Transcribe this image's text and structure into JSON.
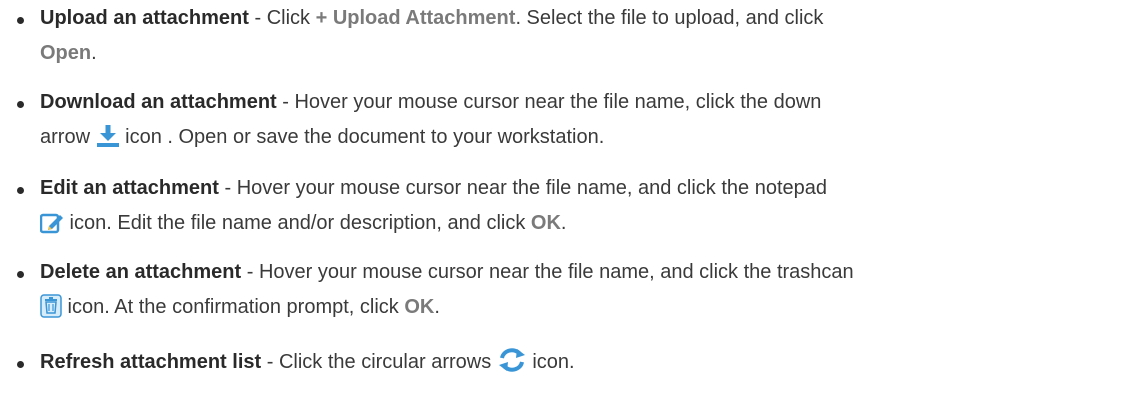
{
  "items": [
    {
      "title": "Upload an attachment",
      "sep": " - Click ",
      "ui1": "+ Upload Attachment",
      "mid": ". Select the file to upload, and click ",
      "ui2": "Open",
      "end": "."
    },
    {
      "title": "Download an attachment",
      "text1": " - Hover your mouse cursor near the file name, click the down",
      "text2a": "arrow ",
      "text2b": " icon . Open or save the document to your workstation.",
      "icon": "download-icon"
    },
    {
      "title": "Edit an attachment",
      "text1": " - Hover your mouse cursor near the file name, and click the notepad",
      "text2": " icon. Edit the file name and/or description, and click ",
      "ui": "OK",
      "end": ".",
      "icon": "notepad-edit-icon"
    },
    {
      "title": "Delete an attachment",
      "text1": " - Hover your mouse cursor near the file name, and click the trashcan",
      "text2": " icon. At the confirmation prompt, click ",
      "ui": "OK",
      "end": ".",
      "icon": "trashcan-icon"
    },
    {
      "title": "Refresh attachment list",
      "text1": " - Click the circular arrows ",
      "text2": " icon.",
      "icon": "refresh-icon"
    }
  ],
  "colors": {
    "text": "#3a3a3a",
    "ui_label": "#7a7a7a",
    "icon_blue": "#3a95d6",
    "icon_yellow": "#f6c342"
  }
}
